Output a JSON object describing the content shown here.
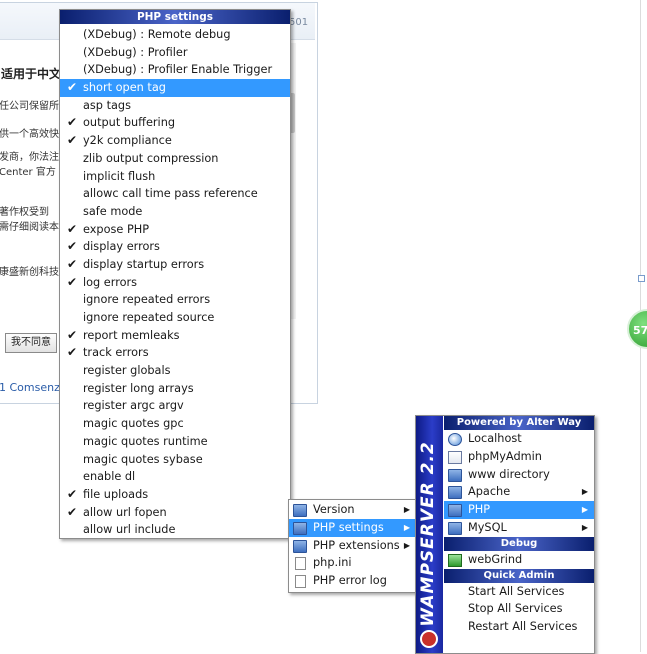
{
  "background_page": {
    "top_number": "501",
    "title": "适用于中文",
    "lines": [
      "任公司保留所",
      "供一个高效快",
      "发商，你法注",
      "Center 官方",
      "著作权受到",
      "需仔细阅读本",
      "康盛新创科技"
    ],
    "decline_button": "我不同意",
    "footer": "1 Comsenz",
    "badge_text": "57"
  },
  "php_settings_menu": {
    "header": "PHP settings",
    "items": [
      {
        "label": "(XDebug) : Remote debug",
        "checked": false
      },
      {
        "label": "(XDebug) : Profiler",
        "checked": false
      },
      {
        "label": "(XDebug) : Profiler Enable Trigger",
        "checked": false
      },
      {
        "label": "short open tag",
        "checked": true,
        "selected": true
      },
      {
        "label": "asp tags",
        "checked": false
      },
      {
        "label": "output buffering",
        "checked": true
      },
      {
        "label": "y2k compliance",
        "checked": true
      },
      {
        "label": "zlib output compression",
        "checked": false
      },
      {
        "label": "implicit flush",
        "checked": false
      },
      {
        "label": "allowc call time pass reference",
        "checked": false
      },
      {
        "label": "safe mode",
        "checked": false
      },
      {
        "label": "expose PHP",
        "checked": true
      },
      {
        "label": "display errors",
        "checked": true
      },
      {
        "label": "display startup errors",
        "checked": true
      },
      {
        "label": "log errors",
        "checked": true
      },
      {
        "label": "ignore repeated errors",
        "checked": false
      },
      {
        "label": "ignore repeated source",
        "checked": false
      },
      {
        "label": "report memleaks",
        "checked": true
      },
      {
        "label": "track errors",
        "checked": true
      },
      {
        "label": "register globals",
        "checked": false
      },
      {
        "label": "register long arrays",
        "checked": false
      },
      {
        "label": "register argc argv",
        "checked": false
      },
      {
        "label": "magic quotes gpc",
        "checked": false
      },
      {
        "label": "magic quotes runtime",
        "checked": false
      },
      {
        "label": "magic quotes sybase",
        "checked": false
      },
      {
        "label": "enable dl",
        "checked": false
      },
      {
        "label": "file uploads",
        "checked": true
      },
      {
        "label": "allow url fopen",
        "checked": true
      },
      {
        "label": "allow url include",
        "checked": false
      }
    ]
  },
  "php_submenu": {
    "items": [
      {
        "label": "Version",
        "icon": "folder",
        "has_submenu": true
      },
      {
        "label": "PHP settings",
        "icon": "folder",
        "has_submenu": true,
        "selected": true
      },
      {
        "label": "PHP extensions",
        "icon": "folder",
        "has_submenu": true
      },
      {
        "label": "php.ini",
        "icon": "file"
      },
      {
        "label": "PHP error log",
        "icon": "file"
      }
    ]
  },
  "wamp_menu": {
    "side_title": "WAMPSERVER 2.2",
    "powered_header": "Powered by Alter Way",
    "items": [
      {
        "label": "Localhost",
        "icon": "globe"
      },
      {
        "label": "phpMyAdmin",
        "icon": "page"
      },
      {
        "label": "www directory",
        "icon": "folder"
      },
      {
        "label": "Apache",
        "icon": "folder",
        "has_submenu": true
      },
      {
        "label": "PHP",
        "icon": "folder",
        "has_submenu": true,
        "selected": true
      },
      {
        "label": "MySQL",
        "icon": "folder",
        "has_submenu": true
      }
    ],
    "debug_header": "Debug",
    "debug_items": [
      {
        "label": "webGrind",
        "icon": "green"
      }
    ],
    "quick_admin_header": "Quick Admin",
    "quick_admin_items": [
      {
        "label": "Start All Services"
      },
      {
        "label": "Stop All Services"
      },
      {
        "label": "Restart All Services"
      }
    ]
  },
  "colors": {
    "selection": "#3399ff",
    "header_dark": "#0a1f6e",
    "wamp_side": "#1a28a0"
  }
}
